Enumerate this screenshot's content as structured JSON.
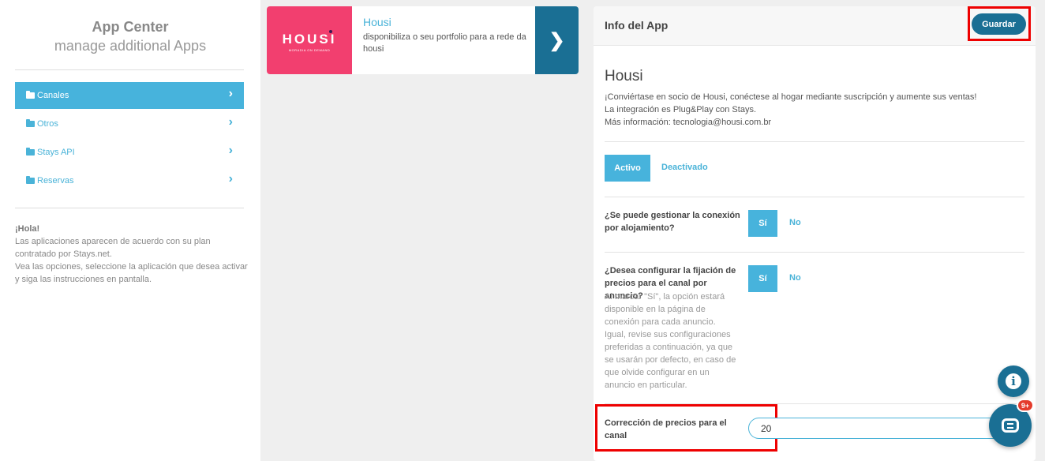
{
  "sidebar": {
    "title": "App Center",
    "subtitle": "manage additional Apps",
    "items": [
      {
        "label": "Canales",
        "active": true
      },
      {
        "label": "Otros",
        "active": false
      },
      {
        "label": "Stays API",
        "active": false
      },
      {
        "label": "Reservas",
        "active": false
      }
    ],
    "hello_title": "¡Hola!",
    "hello_text": "Las aplicaciones aparecen de acuerdo con su plan contratado por Stays.net.",
    "hello_text2": "Vea las opciones, seleccione la aplicación que desea activar y siga las instrucciones en pantalla."
  },
  "app_card": {
    "logo_text": "HOUSI",
    "logo_sub": "MORADIA ON DEMAND",
    "name": "Housi",
    "description": "disponibiliza o seu portfolio para a rede da housi",
    "open_icon": "chevron-right-icon"
  },
  "panel": {
    "title": "Info del App",
    "save_label": "Guardar",
    "app_name": "Housi",
    "desc_line1": "¡Conviértase en socio de Housi, conéctese al hogar mediante suscripción y aumente sus ventas!",
    "desc_line2": "La integración es Plug&Play con Stays.",
    "desc_line3": "Más información: tecnologia@housi.com.br",
    "status": {
      "active_label": "Activo",
      "inactive_label": "Deactivado"
    },
    "q1": {
      "label": "¿Se puede gestionar la conexión por alojamiento?",
      "yes": "Sí",
      "no": "No"
    },
    "q2": {
      "label": "¿Desea configurar la fijación de precios para el canal por anuncio?",
      "help": "Al marcar \"Sí\", la opción estará disponible en la página de conexión para cada anuncio. Igual, revise sus configuraciones preferidas a continuación, ya que se usarán por defecto, en caso de que olvide configurar en un anuncio en particular.",
      "yes": "Sí",
      "no": "No"
    },
    "price": {
      "label": "Corrección de precios para el canal",
      "value": "20"
    }
  },
  "floating": {
    "info_icon": "info-icon",
    "chat_icon": "chat-icon",
    "badge": "9+"
  },
  "colors": {
    "accent": "#47b3dc",
    "primary_dark": "#1a6f94",
    "brand": "#f23f6f",
    "highlight": "#e00000",
    "badge": "#e43c2c"
  }
}
